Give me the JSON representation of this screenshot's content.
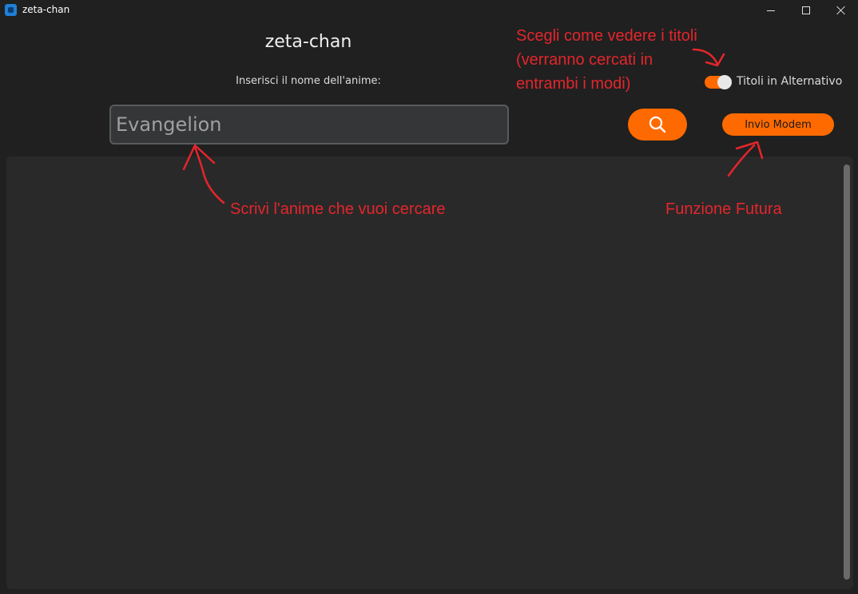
{
  "window": {
    "title": "zeta-chan"
  },
  "header": {
    "app_name": "zeta-chan",
    "input_label": "Inserisci il nome dell'anime:"
  },
  "search": {
    "value": "Evangelion",
    "icon": "search-icon"
  },
  "toggle": {
    "label": "Titoli in Alternativo",
    "state": "on"
  },
  "modem_button": {
    "label": "Invio Modem"
  },
  "annotations": {
    "titles_line1": "Scegli come vedere i titoli",
    "titles_line2": "(verranno cercati in",
    "titles_line3": "entrambi i modi)",
    "search_note": "Scrivi l'anime che vuoi cercare",
    "future_note": "Funzione Futura"
  },
  "colors": {
    "accent": "#ff6a00",
    "annotation": "#e3262c",
    "background": "#202020",
    "panel": "#292929"
  }
}
